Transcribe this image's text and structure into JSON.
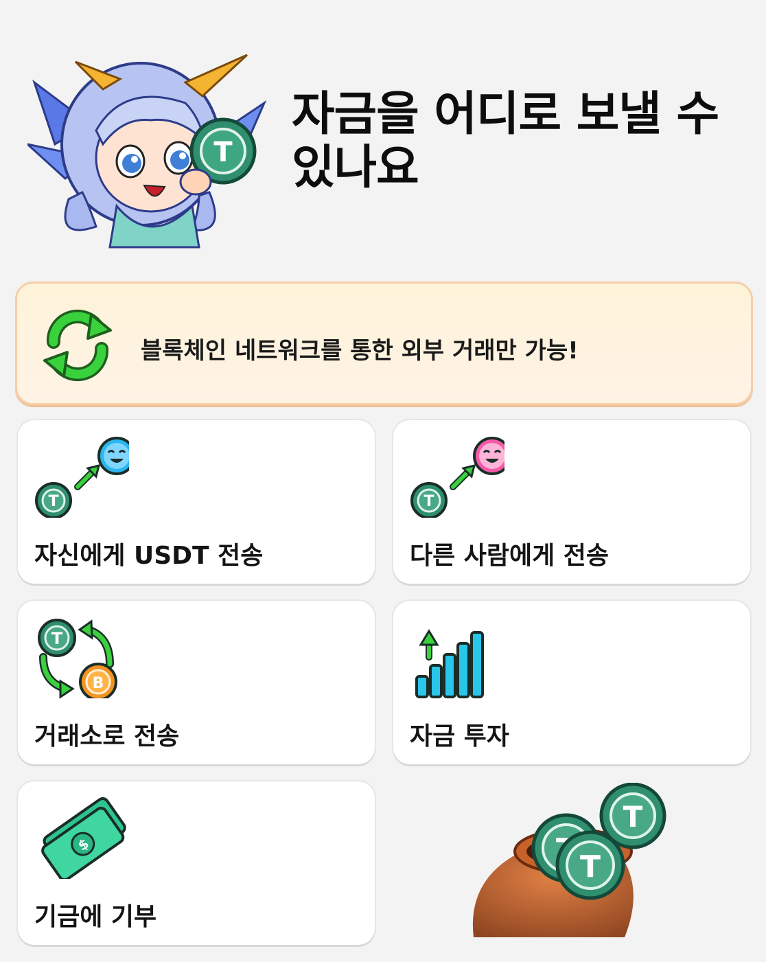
{
  "header": {
    "title_line1": "자금을 어디로 보낼 수",
    "title_line2": "있나요"
  },
  "notice": {
    "text": "블록체인 네트워크를 통한 외부 거래만 가능!",
    "icon": "refresh-arrows-icon"
  },
  "options": [
    {
      "label": "자신에게 USDT 전송",
      "icon": "send-to-self-icon"
    },
    {
      "label": "다른 사람에게 전송",
      "icon": "send-to-other-icon"
    },
    {
      "label": "거래소로 전송",
      "icon": "exchange-swap-icon"
    },
    {
      "label": "자금 투자",
      "icon": "invest-bars-icon"
    },
    {
      "label": "기금에 기부",
      "icon": "cash-bills-icon"
    }
  ],
  "colors": {
    "usdt_green": "#2f8f6e",
    "accent_green": "#2ec43a",
    "notice_border": "#f6cfa8",
    "blue_face": "#2bb6f0",
    "pink_face": "#f25aa8"
  }
}
